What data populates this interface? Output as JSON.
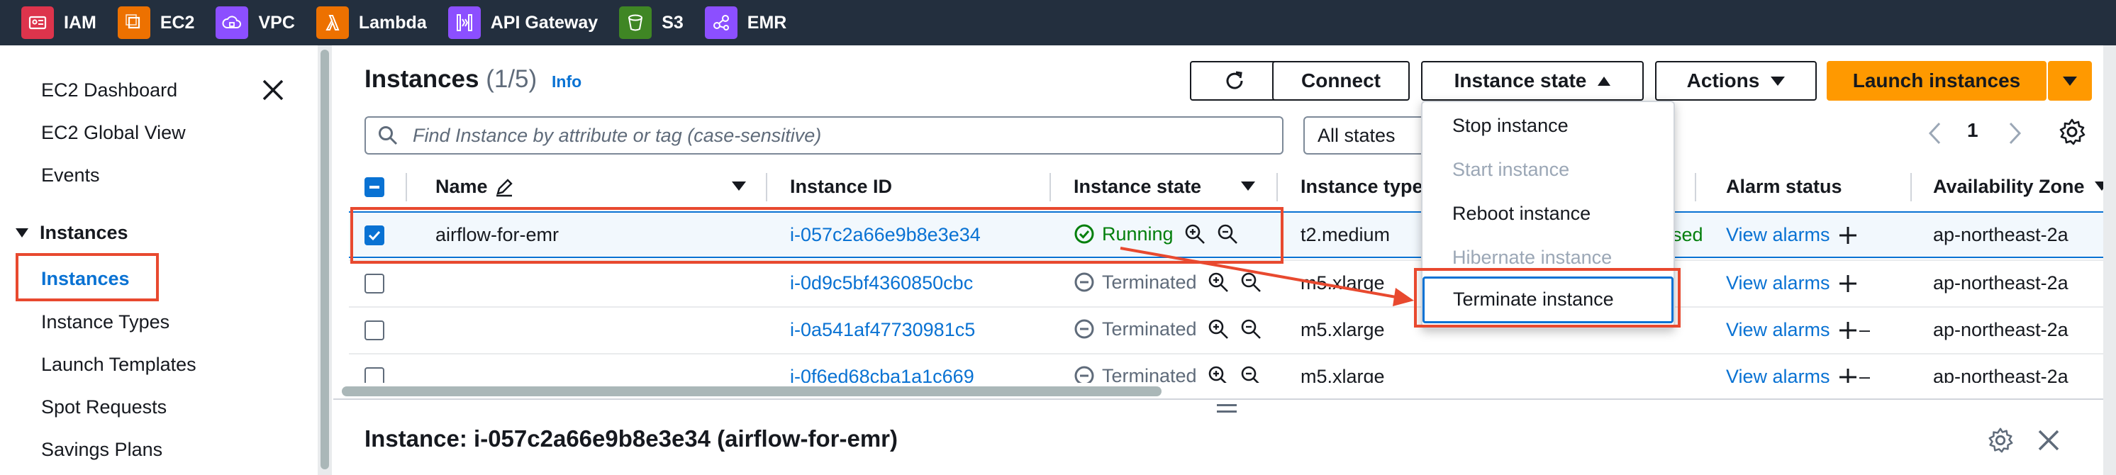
{
  "favorites": [
    {
      "label": "IAM",
      "icon": "iam-icon",
      "color": "#dd344c"
    },
    {
      "label": "EC2",
      "icon": "ec2-icon",
      "color": "#ed7100"
    },
    {
      "label": "VPC",
      "icon": "vpc-icon",
      "color": "#8c4fff"
    },
    {
      "label": "Lambda",
      "icon": "lambda-icon",
      "color": "#ed7100"
    },
    {
      "label": "API Gateway",
      "icon": "api-gateway-icon",
      "color": "#8c4fff"
    },
    {
      "label": "S3",
      "icon": "s3-icon",
      "color": "#3f8624"
    },
    {
      "label": "EMR",
      "icon": "emr-icon",
      "color": "#8c4fff"
    }
  ],
  "sidebar": {
    "dashboard": "EC2 Dashboard",
    "global_view": "EC2 Global View",
    "events": "Events",
    "section": "Instances",
    "active": "Instances",
    "items": [
      "Instance Types",
      "Launch Templates",
      "Spot Requests",
      "Savings Plans"
    ]
  },
  "header": {
    "title": "Instances",
    "count": "(1/5)",
    "info": "Info",
    "connect": "Connect",
    "instance_state": "Instance state",
    "actions": "Actions",
    "launch": "Launch instances"
  },
  "search": {
    "placeholder": "Find Instance by attribute or tag (case-sensitive)",
    "states_filter": "All states"
  },
  "pagination": {
    "current": "1"
  },
  "columns": {
    "name": "Name",
    "instance_id": "Instance ID",
    "instance_state": "Instance state",
    "instance_type": "Instance type",
    "alarm_status": "Alarm status",
    "availability_zone": "Availability Zone"
  },
  "rows": [
    {
      "name": "airflow-for-emr",
      "id": "i-057c2a66e9b8e3e34",
      "state": "Running",
      "type": "t2.medium",
      "status_check": "",
      "status_tail": "sed",
      "alarm": "View alarms",
      "az": "ap-northeast-2a",
      "selected": true
    },
    {
      "name": "",
      "id": "i-0d9c5bf4360850cbc",
      "state": "Terminated",
      "type": "m5.xlarge",
      "status_check": "",
      "status_tail": "",
      "alarm": "View alarms",
      "az": "ap-northeast-2a",
      "selected": false
    },
    {
      "name": "",
      "id": "i-0a541af47730981c5",
      "state": "Terminated",
      "type": "m5.xlarge",
      "status_check": "–",
      "status_tail": "",
      "alarm": "View alarms",
      "az": "ap-northeast-2a",
      "selected": false
    },
    {
      "name": "",
      "id": "i-0f6ed68cba1a1c669",
      "state": "Terminated",
      "type": "m5.xlarge",
      "status_check": "–",
      "status_tail": "",
      "alarm": "View alarms",
      "az": "ap-northeast-2a",
      "selected": false
    }
  ],
  "menu": {
    "stop": "Stop instance",
    "start": "Start instance",
    "reboot": "Reboot instance",
    "hibernate": "Hibernate instance",
    "terminate": "Terminate instance"
  },
  "split": {
    "title": "Instance: i-057c2a66e9b8e3e34 (airflow-for-emr)"
  },
  "colors": {
    "nav_bg": "#232f3e",
    "link": "#0972d3",
    "primary": "#ff9900",
    "running": "#037f0c",
    "annotation": "#e8492f"
  }
}
